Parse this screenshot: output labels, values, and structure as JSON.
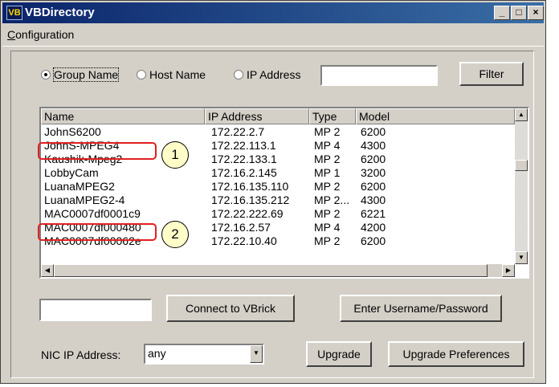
{
  "window": {
    "title": "VBDirectory",
    "icon": "vb-app-icon",
    "controls": [
      "_",
      "□",
      "×"
    ]
  },
  "menu": {
    "configuration": "Configuration"
  },
  "search": {
    "options": [
      "Group Name",
      "Host Name",
      "IP Address"
    ],
    "selected": "Group Name",
    "value": "",
    "filter_label": "Filter"
  },
  "list": {
    "columns": [
      "Name",
      "IP Address",
      "Type",
      "Model"
    ],
    "rows": [
      [
        "JohnS6200",
        "172.22.2.7",
        "MP 2",
        "6200"
      ],
      [
        "JohnS-MPEG4",
        "172.22.113.1",
        "MP 4",
        "4300"
      ],
      [
        "Kaushik-Mpeg2",
        "172.22.133.1",
        "MP 2",
        "6200"
      ],
      [
        "LobbyCam",
        "172.16.2.145",
        "MP 1",
        "3200"
      ],
      [
        "LuanaMPEG2",
        "172.16.135.110",
        "MP 2",
        "6200"
      ],
      [
        "LuanaMPEG2-4",
        "172.16.135.212",
        "MP 2...",
        "4300"
      ],
      [
        "MAC0007df0001c9",
        "172.22.222.69",
        "MP 2",
        "6221"
      ],
      [
        "MAC0007df000480",
        "172.16.2.57",
        "MP 4",
        "4200"
      ],
      [
        "MAC0007df00062e",
        "172.22.10.40",
        "MP 2",
        "6200"
      ]
    ]
  },
  "callouts": [
    "1",
    "2"
  ],
  "connect": {
    "value": "",
    "button": "Connect to VBrick"
  },
  "credentials_button": "Enter Username/Password",
  "nic": {
    "label": "NIC IP Address:",
    "value": "any"
  },
  "upgrade_button": "Upgrade",
  "upgrade_prefs_button": "Upgrade Preferences",
  "colors": {
    "titlebar": "#0a246a",
    "callout": "#e02020",
    "face": "#d4d0c8"
  }
}
